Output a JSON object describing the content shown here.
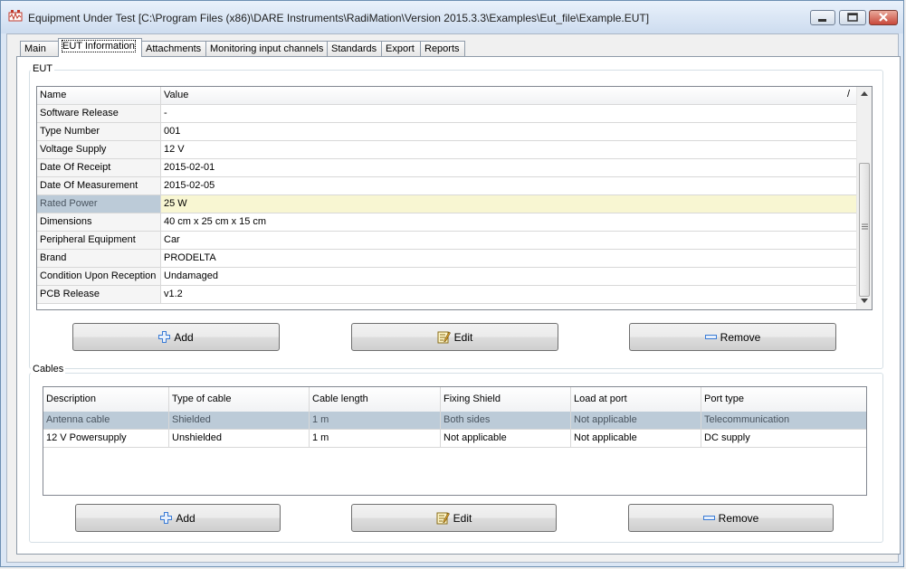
{
  "window": {
    "title": "Equipment Under Test [C:\\Program Files (x86)\\DARE Instruments\\RadiMation\\Version 2015.3.3\\Examples\\Eut_file\\Example.EUT]"
  },
  "tabs": [
    "Main",
    "EUT Information",
    "Attachments",
    "Monitoring input channels",
    "Standards",
    "Export",
    "Reports"
  ],
  "active_tab": "EUT Information",
  "eut": {
    "group_label": "EUT",
    "columns": [
      "Name",
      "Value"
    ],
    "sort_indicator": "/",
    "rows": [
      {
        "name": "Software Release",
        "value": "-"
      },
      {
        "name": "Type Number",
        "value": "001"
      },
      {
        "name": "Voltage Supply",
        "value": "12 V"
      },
      {
        "name": "Date Of Receipt",
        "value": "2015-02-01"
      },
      {
        "name": "Date Of Measurement",
        "value": "2015-02-05"
      },
      {
        "name": "Rated Power",
        "value": "25 W"
      },
      {
        "name": "Dimensions",
        "value": "40 cm x 25 cm x 15 cm"
      },
      {
        "name": "Peripheral Equipment",
        "value": "Car"
      },
      {
        "name": "Brand",
        "value": "PRODELTA"
      },
      {
        "name": "Condition Upon Reception",
        "value": "Undamaged"
      },
      {
        "name": "PCB Release",
        "value": "v1.2"
      }
    ],
    "selected_row": "Rated Power",
    "buttons": {
      "add": "Add",
      "edit": "Edit",
      "remove": "Remove"
    }
  },
  "cables": {
    "group_label": "Cables",
    "columns": [
      "Description",
      "Type of cable",
      "Cable length",
      "Fixing Shield",
      "Load at port",
      "Port type"
    ],
    "rows": [
      [
        "Antenna cable",
        "Shielded",
        "1 m",
        "Both sides",
        "Not applicable",
        "Telecommunication"
      ],
      [
        "12 V Powersupply",
        "Unshielded",
        "1 m",
        "Not applicable",
        "Not applicable",
        "DC supply"
      ]
    ],
    "selected_row": "Antenna cable",
    "buttons": {
      "add": "Add",
      "edit": "Edit",
      "remove": "Remove"
    }
  },
  "colors": {
    "selected_row_bg": "#bccbd8",
    "selected_value_bg": "#f8f6d2",
    "name_column_bg": "#f5f5f5",
    "add_icon": "#3a7bd5"
  }
}
